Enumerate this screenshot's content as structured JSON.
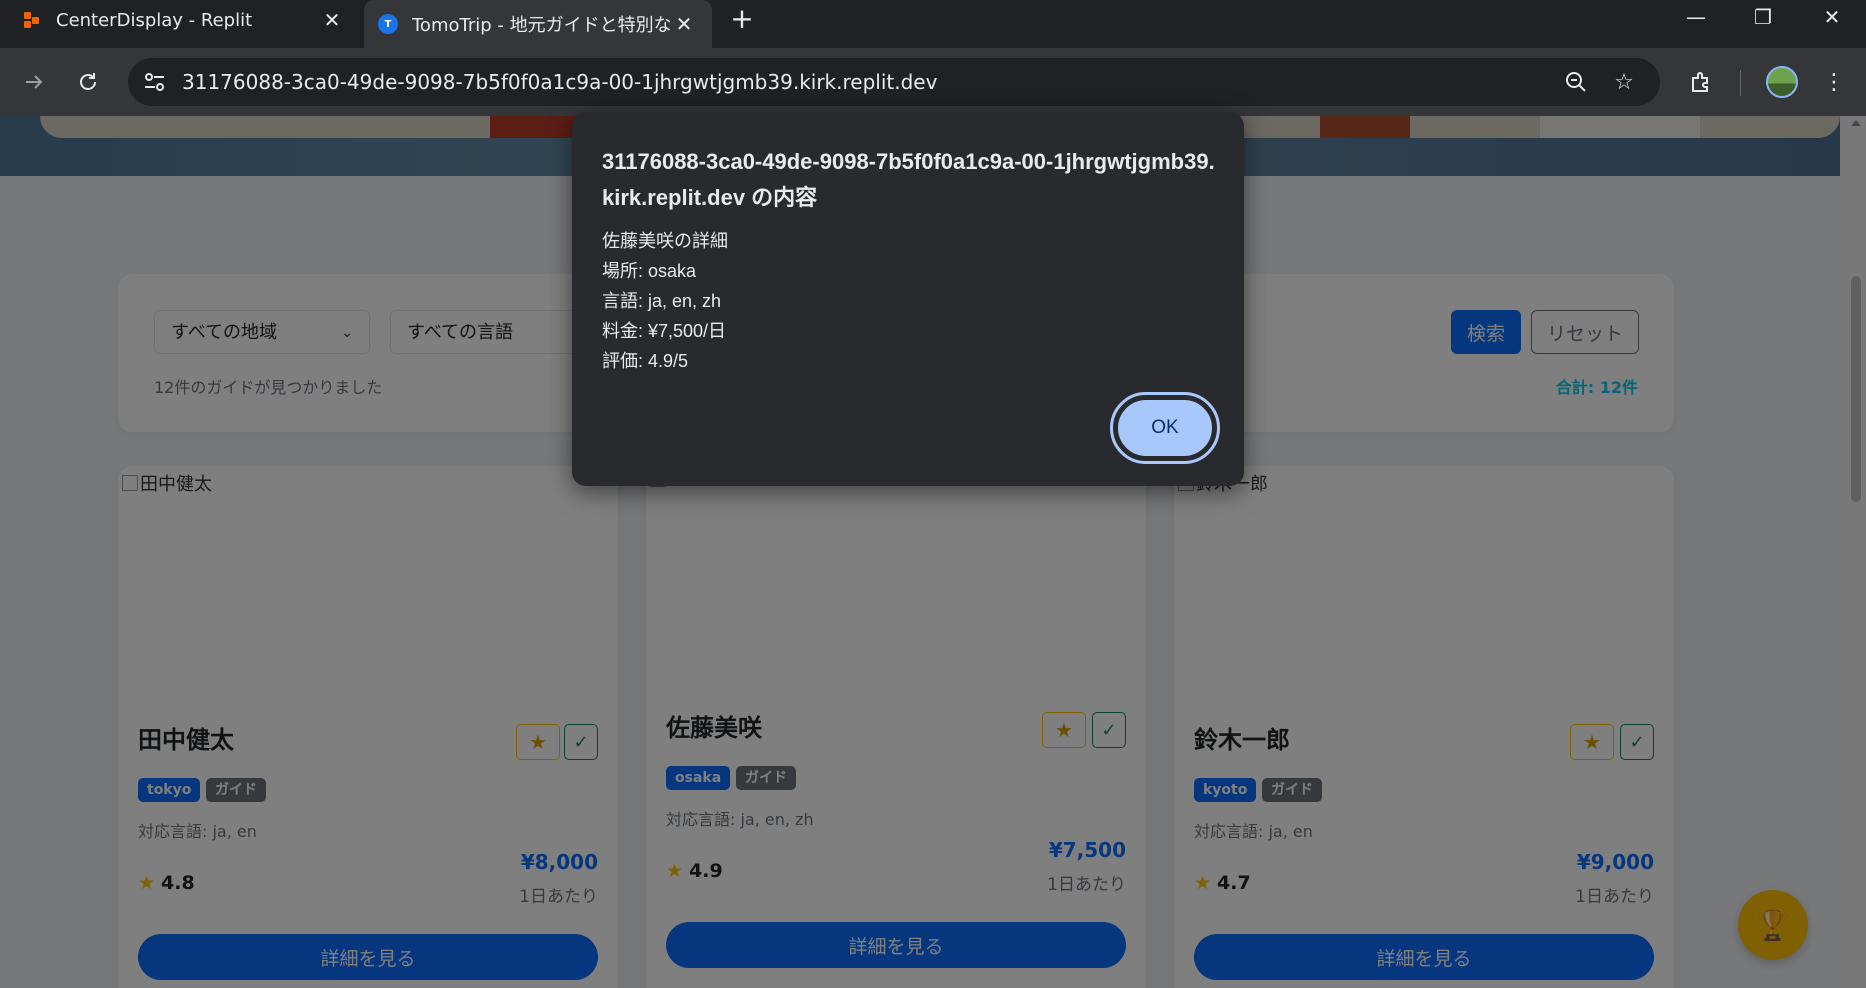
{
  "browser": {
    "tabs": [
      {
        "title": "CenterDisplay - Replit",
        "close": "✕"
      },
      {
        "title": "TomoTrip - 地元ガイドと特別な旅",
        "close": "✕"
      }
    ],
    "new_tab": "+",
    "window_controls": {
      "minimize": "—",
      "restore": "❐",
      "close": "✕"
    },
    "url": "31176088-3ca0-49de-9098-7b5f0f0a1c9a-00-1jhrgwtjgmb39.kirk.replit.dev"
  },
  "filters": {
    "region_select": "すべての地域",
    "language_select": "すべての言語",
    "search_button": "検索",
    "reset_button": "リセット",
    "found_text": "12件のガイドが見つかりました",
    "total_text": "合計: 12件"
  },
  "guides": [
    {
      "img_alt": "田中健太",
      "name": "田中健太",
      "location": "tokyo",
      "type": "ガイド",
      "languages": "対応言語: ja, en",
      "rating": "4.8",
      "price": "¥8,000",
      "per_day": "1日あたり",
      "detail_button": "詳細を見る"
    },
    {
      "img_alt": "",
      "name": "佐藤美咲",
      "location": "osaka",
      "type": "ガイド",
      "languages": "対応言語: ja, en, zh",
      "rating": "4.9",
      "price": "¥7,500",
      "per_day": "1日あたり",
      "detail_button": "詳細を見る"
    },
    {
      "img_alt": "鈴木一郎",
      "name": "鈴木一郎",
      "location": "kyoto",
      "type": "ガイド",
      "languages": "対応言語: ja, en",
      "rating": "4.7",
      "price": "¥9,000",
      "per_day": "1日あたり",
      "detail_button": "詳細を見る"
    }
  ],
  "dialog": {
    "title": "31176088-3ca0-49de-9098-7b5f0f0a1c9a-00-1jhrgwtjgmb39.kirk.replit.dev の内容",
    "lines": [
      "佐藤美咲の詳細",
      "場所: osaka",
      "言語: ja, en, zh",
      "料金: ¥7,500/日",
      "評価: 4.9/5"
    ],
    "ok_button": "OK"
  },
  "icons": {
    "star": "★",
    "check": "✓"
  }
}
